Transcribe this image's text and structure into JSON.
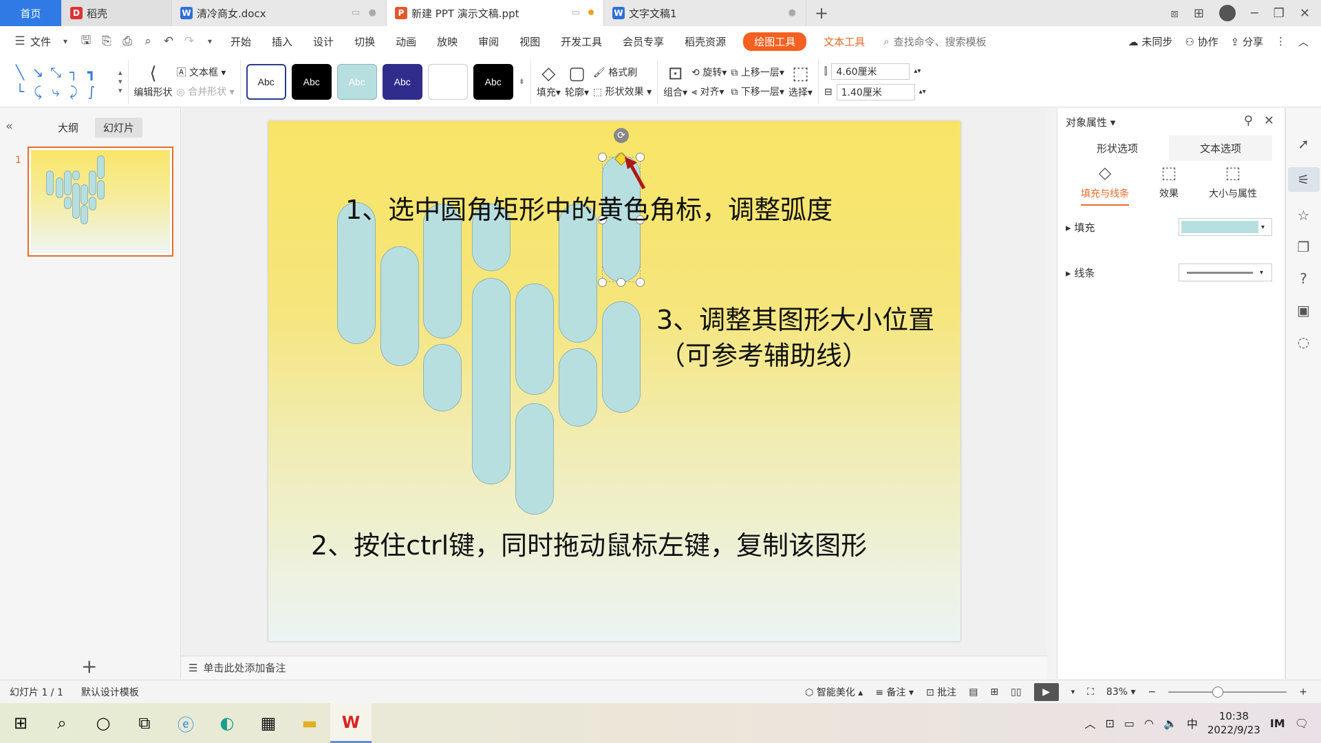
{
  "tabs": {
    "home": "首页",
    "docer": "稻壳",
    "doc1": "清冷商女.docx",
    "ppt": "新建 PPT 演示文稿.ppt",
    "doc2": "文字文稿1"
  },
  "menu": {
    "file": "文件",
    "items": [
      "开始",
      "插入",
      "设计",
      "切换",
      "动画",
      "放映",
      "审阅",
      "视图",
      "开发工具",
      "会员专享",
      "稻壳资源"
    ],
    "drawing_tools": "绘图工具",
    "text_tools": "文本工具",
    "search_placeholder": "查找命令、搜索模板",
    "sync": "未同步",
    "collab": "协作",
    "share": "分享"
  },
  "ribbon": {
    "edit_shape": "编辑形状",
    "text_box": "文本框",
    "merge_shape": "合并形状",
    "style_label": "Abc",
    "fill": "填充",
    "outline": "轮廓",
    "format_painter": "格式刷",
    "shape_effect": "形状效果",
    "group": "组合",
    "rotate": "旋转",
    "align": "对齐",
    "bring_forward": "上移一层",
    "send_backward": "下移一层",
    "select": "选择",
    "height": "4.60厘米",
    "width": "1.40厘米"
  },
  "left_panel": {
    "outline_tab": "大纲",
    "slides_tab": "幻灯片",
    "slide_number": "1"
  },
  "slide": {
    "step1": "1、选中圆角矩形中的黄色角标，调整弧度",
    "step2": "2、按住ctrl键，同时拖动鼠标左键，复制该图形",
    "step3_line1": "3、调整其图形大小位置",
    "step3_line2": "（可参考辅助线）"
  },
  "notes_placeholder": "单击此处添加备注",
  "right_pane": {
    "title": "对象属性",
    "tab_shape": "形状选项",
    "tab_text": "文本选项",
    "sub_fill_line": "填充与线条",
    "sub_effect": "效果",
    "sub_size": "大小与属性",
    "fill": "填充",
    "line": "线条"
  },
  "status": {
    "slide_info": "幻灯片 1 / 1",
    "template": "默认设计模板",
    "smart": "智能美化",
    "notes": "备注",
    "comment": "批注",
    "zoom": "83%"
  },
  "taskbar": {
    "ime": "中",
    "time": "10:38",
    "date": "2022/9/23"
  },
  "colors": {
    "accent": "#f4601f",
    "home_tab": "#2f7ae5",
    "shape_fill": "#b8dfe0"
  }
}
